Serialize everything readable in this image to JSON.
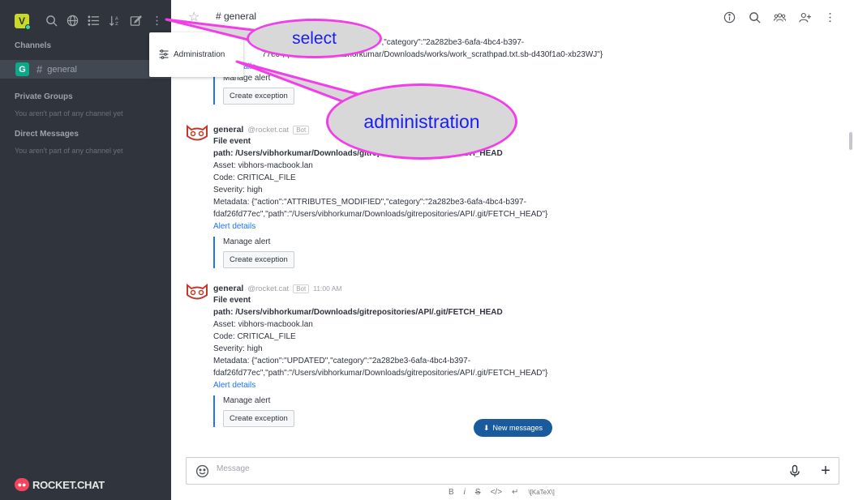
{
  "sidebar": {
    "user_initial": "V",
    "channels_heading": "Channels",
    "channel": {
      "avatar": "G",
      "name": "general"
    },
    "private_heading": "Private Groups",
    "private_empty": "You aren't part of any channel yet",
    "direct_heading": "Direct Messages",
    "direct_empty": "You aren't part of any channel yet",
    "logo_text": "ROCKET.CHAT"
  },
  "dropdown": {
    "admin_label": "Administration"
  },
  "header": {
    "room_title": "# general"
  },
  "messages": {
    "partial": {
      "line1": "ED\",\"category\":\"2a282be3-6afa-4bc4-b397-",
      "line2": "77ec\",\"path\":\"/Users/vibhorkumar/Downloads/works/work_scrathpad.txt.sb-d430f1a0-xb23WJ\"}",
      "link": "Alert details",
      "manage": "Manage alert",
      "button": "Create exception"
    },
    "items": [
      {
        "user": "general",
        "handle": "@rocket.cat",
        "bot": "Bot",
        "time": "",
        "title": "File event",
        "path": "path: /Users/vibhorkumar/Downloads/gitrepositories/API/.git/FETCH_HEAD",
        "asset": "Asset: vibhors-macbook.lan",
        "code": "Code: CRITICAL_FILE",
        "severity": "Severity: high",
        "metadata1": "Metadata: {\"action\":\"ATTRIBUTES_MODIFIED\",\"category\":\"2a282be3-6afa-4bc4-b397-",
        "metadata2": "fdaf26fd77ec\",\"path\":\"/Users/vibhorkumar/Downloads/gitrepositories/API/.git/FETCH_HEAD\"}",
        "link": "Alert details",
        "manage": "Manage alert",
        "button": "Create exception"
      },
      {
        "user": "general",
        "handle": "@rocket.cat",
        "bot": "Bot",
        "time": "11:00 AM",
        "title": "File event",
        "path": "path: /Users/vibhorkumar/Downloads/gitrepositories/API/.git/FETCH_HEAD",
        "asset": "Asset: vibhors-macbook.lan",
        "code": "Code: CRITICAL_FILE",
        "severity": "Severity: high",
        "metadata1": "Metadata: {\"action\":\"UPDATED\",\"category\":\"2a282be3-6afa-4bc4-b397-",
        "metadata2": "fdaf26fd77ec\",\"path\":\"/Users/vibhorkumar/Downloads/gitrepositories/API/.git/FETCH_HEAD\"}",
        "link": "Alert details",
        "manage": "Manage alert",
        "button": "Create exception"
      }
    ]
  },
  "new_messages": "New messages",
  "composer": {
    "placeholder": "Message",
    "formatting": [
      "B",
      "i",
      "S",
      "</>",
      "↵",
      "\\[KaTeX\\]"
    ]
  },
  "callouts": {
    "select": "select",
    "administration": "administration"
  },
  "colors": {
    "sidebar_bg": "#2f343d",
    "accent": "#1d74f5",
    "callout_border": "#f23ee9",
    "callout_text": "#1a1ff0"
  }
}
